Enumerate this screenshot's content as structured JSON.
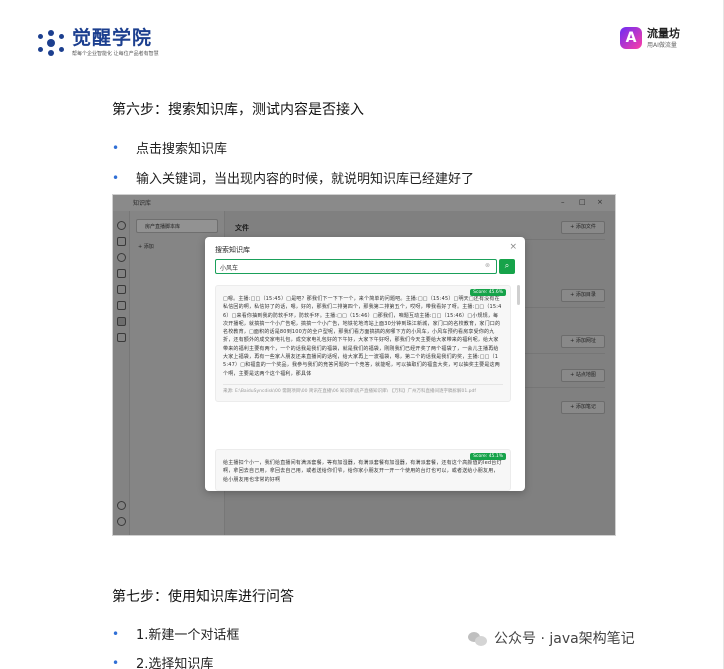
{
  "header": {
    "logo_left_name": "觉醒学院",
    "logo_left_slogan": "帮每个企业智能化 让每位产品者有智慧",
    "logo_right_name": "流量坊",
    "logo_right_sub": "用AI做流量"
  },
  "content": {
    "step6_title": "第六步：搜索知识库，测试内容是否接入",
    "step6_bullets": [
      "点击搜索知识库",
      "输入关键词，当出现内容的时候，就说明知识库已经建好了"
    ],
    "step7_title": "第七步：使用知识库进行问答",
    "step7_bullets": [
      "1.新建一个对话框",
      "2.选择知识库"
    ]
  },
  "screenshot": {
    "app_title": "知识库",
    "win_controls": [
      "–",
      "□",
      "×"
    ],
    "sidebar_item": "房产直播脚本库",
    "sidebar_add": "+ 添加",
    "file_title": "文件",
    "section_buttons": [
      "+ 添加文件",
      "+ 添加目录",
      "+ 添加网址",
      "+ 站点地图",
      "+ 添加笔记"
    ],
    "modal": {
      "title": "搜索知识库",
      "close": "×",
      "query": "小风车",
      "results": [
        {
          "score": "Score: 45.6%",
          "text": "□嗯。主播:□□（15:45）□是吧？那我们下一下下一个，来个简单的问题吧。主播:□□（15:45）□明天□还有没有在私信回的啊，私信好了的话，嗯，好的，那我们二排第四个，那我第二排第五个，哎呀，带我看好了呀。主播:□□（15:46）□来看你抽到我的防软手环，防软手环。主播:□□（15:46）□那我们，咱题互动主播:□□（15:46）□小规规，每次开播呢，就搞搞一个小广告呢，搞搞一个小广告，地铁花地湾站上面30分钟到珠江新城，家门口的名校教育，家门口的名校教育，□面积的话是80到100方的全户型呢，那我们看方面搞搞的房哪下方的小风车，小风车预约看房享受你的九折，还有额外的成交家电礼包，成交家电礼包好的下午好，大家下午好呀，那我们今天主要给大家带来的福利呢，给大家带来的福利主要有两个，一个的话我是我们的福袋，就是我们的福袋，刚刚我们已经开奖了两个福袋了，一会儿主播再给大家上福袋，再有一些家人朋友还来直播间的话呢，给大家再上一波福袋，嗯，第二个的话我是我们的奖，主播:□□（15:47）□和福盒的一个奖品，我参与我们的竞答问题的一个竞答，就能呢，可以抽取们的福盒大奖，可以抽奖主要是这两个啊，主要是这两个这个福利，那具体",
          "source": "来源: E:\\BaiduSyncdisk\\00 需期项目\\00 简讯在直播\\06 知识库\\房产直播知识库\\ 【万科】广州万科直播间逐字稿拆解01.pdf"
        },
        {
          "score": "Score: 45.1%",
          "text": "给主播扣个小一，我们给直播间有满派套餐，等有加湿器，有满派套餐有加湿器，有满派套餐，还有这个高颜值的led台灯啊，拿回去自己用，拿回去自己用，或者送给你们爷，给你家小朋友开一开一个使用的台灯也可以，或者送给小朋友用，给小朋友用也非常的好啊"
        }
      ]
    }
  },
  "watermark": "公众号 · java架构笔记"
}
